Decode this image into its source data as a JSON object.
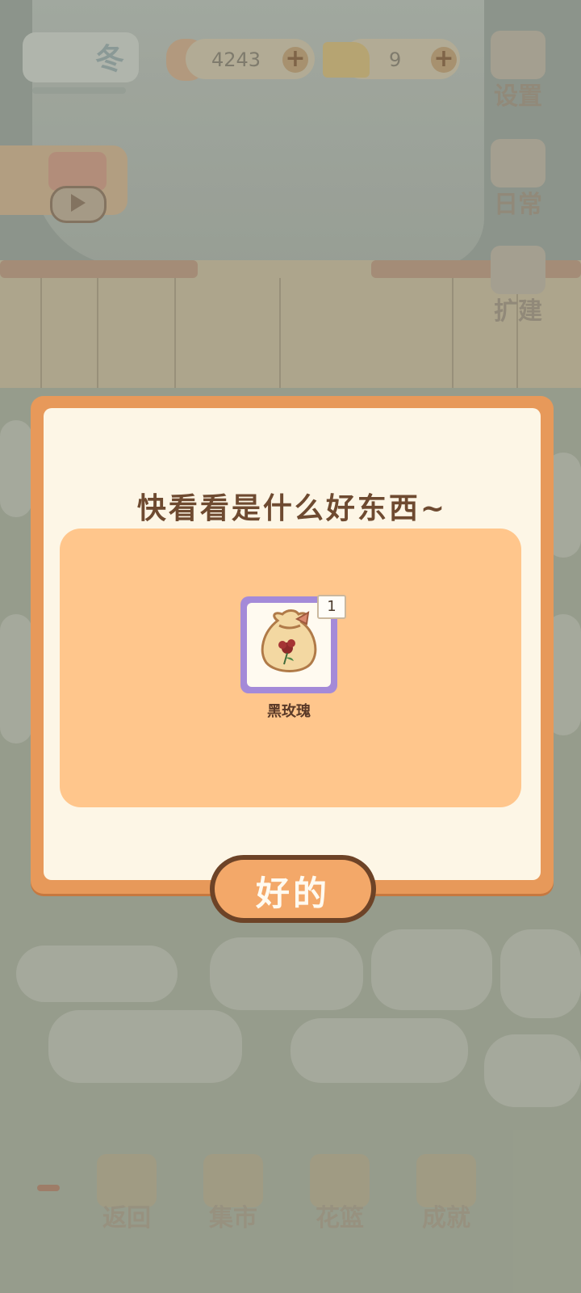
{
  "topbar": {
    "season": "冬",
    "fish_coins": "4243",
    "cheese": "9"
  },
  "side_menu": [
    {
      "label": "设置",
      "icon": "gear-icon"
    },
    {
      "label": "日常",
      "icon": "calendar-papers-icon"
    },
    {
      "label": "扩建",
      "icon": "hammer-icon"
    }
  ],
  "bottom_nav": [
    {
      "label": "返回",
      "icon": "window-icon"
    },
    {
      "label": "集市",
      "icon": "market-stall-icon"
    },
    {
      "label": "花篮",
      "icon": "flower-basket-icon"
    },
    {
      "label": "成就",
      "icon": "trophy-icon"
    }
  ],
  "dialog": {
    "title": "快看看是什么好东西~",
    "reward": {
      "name": "黑玫瑰",
      "quantity": "1",
      "icon": "seed-bag-rose-icon"
    },
    "confirm_label": "好的"
  },
  "colors": {
    "dialog_border": "#e7995a",
    "dialog_bg": "#fdf6e6",
    "reward_panel": "#ffc68c",
    "item_frame": "#a48ad8",
    "button_fill": "#f3a869",
    "button_border": "#6d4327"
  }
}
